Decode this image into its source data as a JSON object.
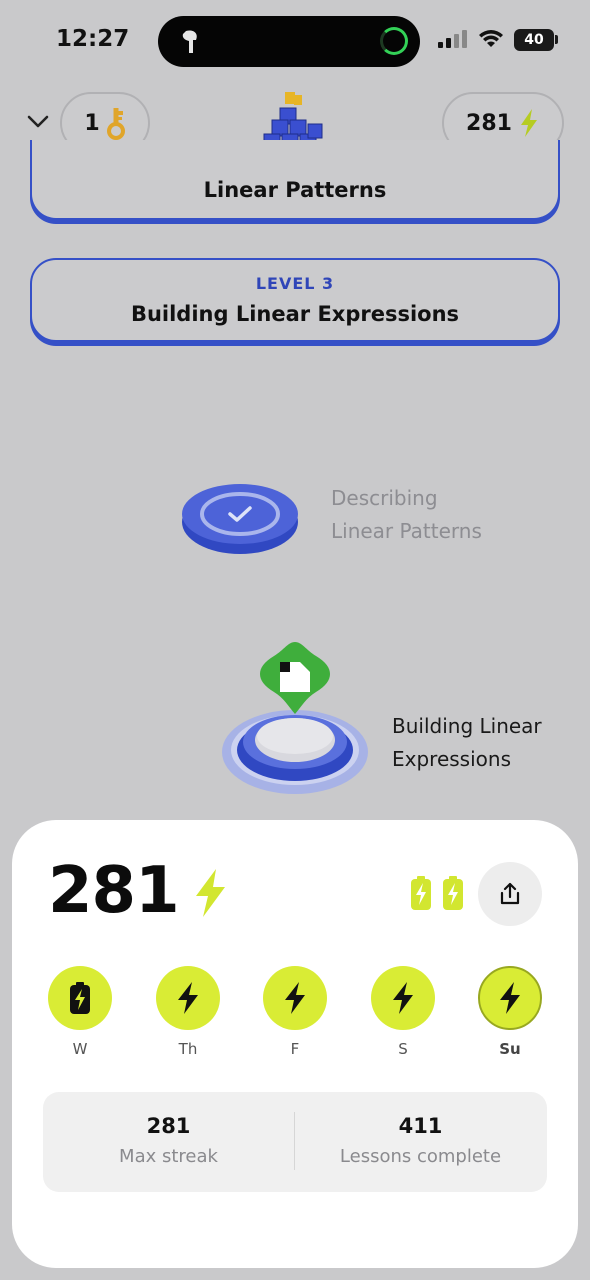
{
  "status_bar": {
    "time": "12:27",
    "battery": "40"
  },
  "header": {
    "keys_count": "1",
    "energy_count": "281"
  },
  "levels": [
    {
      "label": "",
      "title": "Linear Patterns"
    },
    {
      "label": "LEVEL 3",
      "title": "Building Linear Expressions"
    }
  ],
  "lessons": [
    {
      "line1": "Describing",
      "line2": "Linear Patterns",
      "state": "completed"
    },
    {
      "line1": "Building Linear",
      "line2": "Expressions",
      "state": "current"
    }
  ],
  "streak": {
    "count": "281",
    "days": [
      {
        "label": "W",
        "icon": "battery-bolt-icon"
      },
      {
        "label": "Th",
        "icon": "bolt-icon"
      },
      {
        "label": "F",
        "icon": "bolt-icon"
      },
      {
        "label": "S",
        "icon": "bolt-icon"
      },
      {
        "label": "Su",
        "icon": "bolt-icon"
      }
    ],
    "stats": {
      "max_streak_value": "281",
      "max_streak_label": "Max streak",
      "lessons_value": "411",
      "lessons_label": "Lessons complete"
    }
  },
  "colors": {
    "accent_blue": "#3550c7",
    "streak_lime": "#d9ec35",
    "key_gold": "#e0a52a",
    "badge_green": "#3fae3c"
  }
}
